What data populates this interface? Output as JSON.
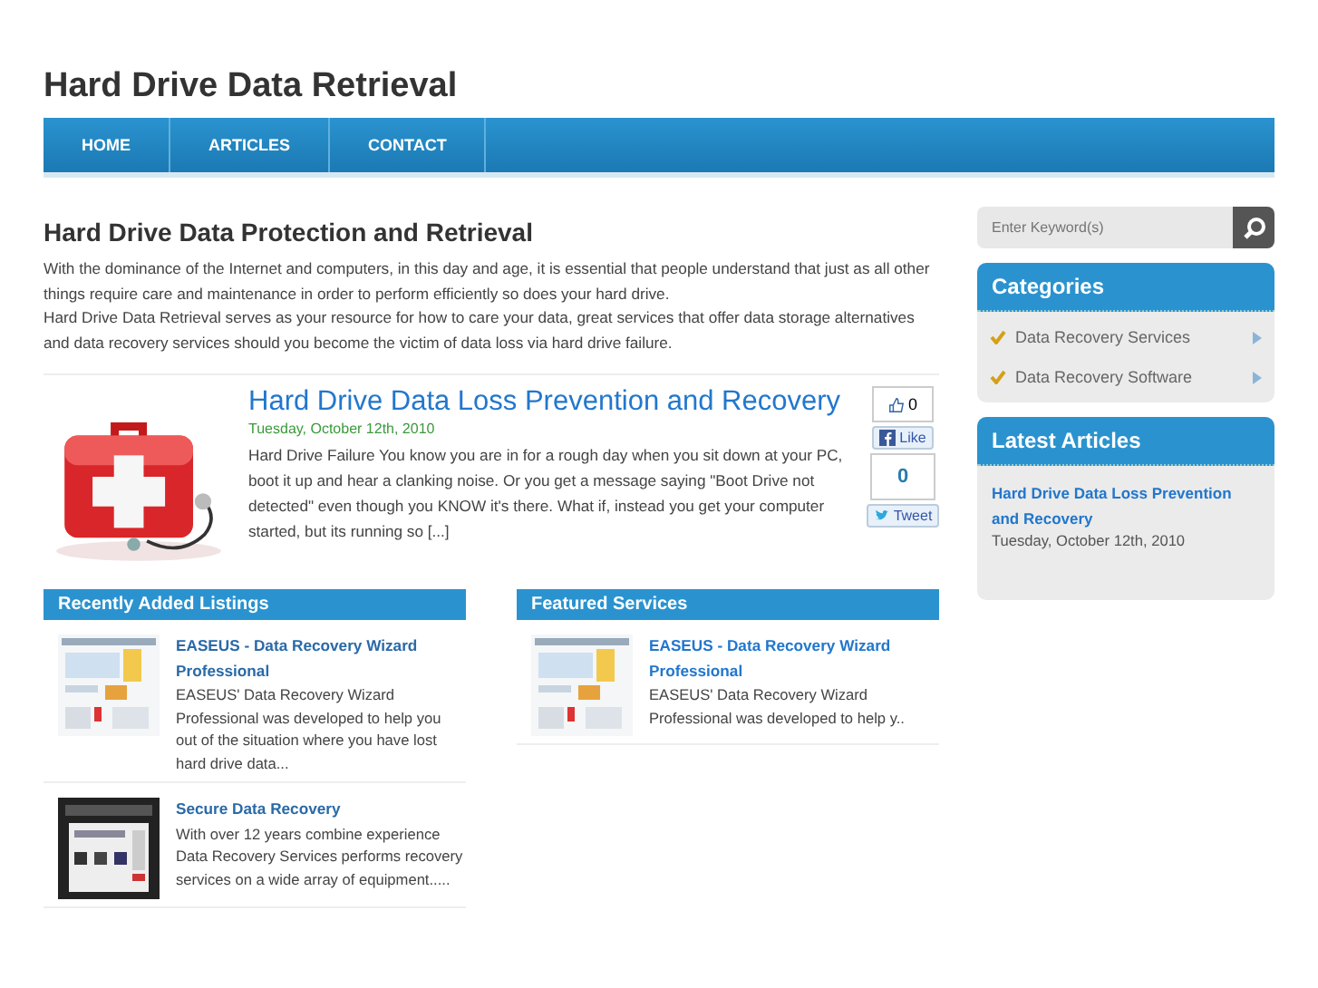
{
  "site_title": "Hard Drive Data Retrieval",
  "nav": [
    {
      "label": "HOME",
      "selected": false
    },
    {
      "label": "ARTICLES",
      "selected": false
    },
    {
      "label": "CONTACT",
      "selected": false
    }
  ],
  "intro": {
    "heading": "Hard Drive Data Protection and Retrieval",
    "paragraphs": [
      "With the dominance of the Internet and computers, in this day and age, it is essential that people understand that just as all other things require care and maintenance in order to perform efficiently so does your hard drive.",
      "Hard Drive Data Retrieval serves as your resource for how to care your data, great services that offer data storage alternatives and data recovery services should you become the victim of data loss via hard drive failure."
    ]
  },
  "post": {
    "title": "Hard Drive Data Loss Prevention and Recovery",
    "date": "Tuesday, October 12th, 2010",
    "excerpt": "Hard Drive Failure You know you are in for a rough day when you sit down at your PC, boot it up and hear a clanking noise.  Or you get a message saying \"Boot Drive not detected\" even though you KNOW it's there.  What if, instead you get your computer started, but its running so [...]",
    "like_count": "0",
    "like_label": "Like",
    "tweet_count": "0",
    "tweet_label": "Tweet"
  },
  "recent_listings": {
    "heading": "Recently Added Listings",
    "items": [
      {
        "title": "EASEUS - Data Recovery Wizard Professional",
        "text": "EASEUS' Data Recovery Wizard Professional was developed to help you out of the situation where you have lost hard drive data..."
      },
      {
        "title": "Secure Data Recovery",
        "text": "With over 12 years combine experience Data Recovery Services performs recovery services on a wide array of equipment....."
      }
    ]
  },
  "featured_services": {
    "heading": "Featured Services",
    "items": [
      {
        "title": "EASEUS - Data Recovery Wizard Professional",
        "text": "EASEUS' Data Recovery Wizard Professional was developed to help y.."
      }
    ]
  },
  "search": {
    "placeholder": "Enter Keyword(s)"
  },
  "categories": {
    "heading": "Categories",
    "items": [
      "Data Recovery Services",
      "Data Recovery Software"
    ]
  },
  "latest_articles": {
    "heading": "Latest Articles",
    "items": [
      {
        "title": "Hard Drive Data Loss Prevention and Recovery",
        "date": "Tuesday, October 12th, 2010"
      }
    ]
  }
}
